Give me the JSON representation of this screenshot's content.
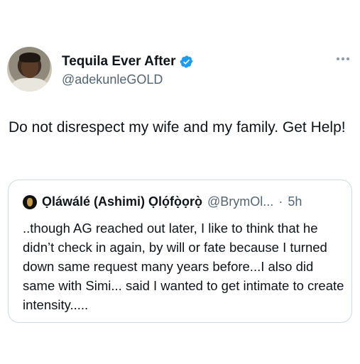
{
  "author": {
    "display_name": "Tequila Ever After",
    "handle": "@adekunleGOLD",
    "verified": true,
    "avatar_icon": "profile-photo"
  },
  "tweet": {
    "text": "Do not disrespect my wife and my family. Get Help!"
  },
  "quoted": {
    "display_name": "Ọláwálé (Ashimi) Ọlọ́fọ̀ọrọ̀",
    "handle": "@BrymOl...",
    "separator": "·",
    "time": "5h",
    "text": "..though AG reached out later, I like to think that he didn’t check in again, by will or fate because I turned down same request many years before...I also did same with Simi... said I wanted to get intimate to create intensity....."
  },
  "colors": {
    "verified_blue": "#1d9bf0",
    "secondary_text": "#536471",
    "border": "#cfd9de"
  }
}
